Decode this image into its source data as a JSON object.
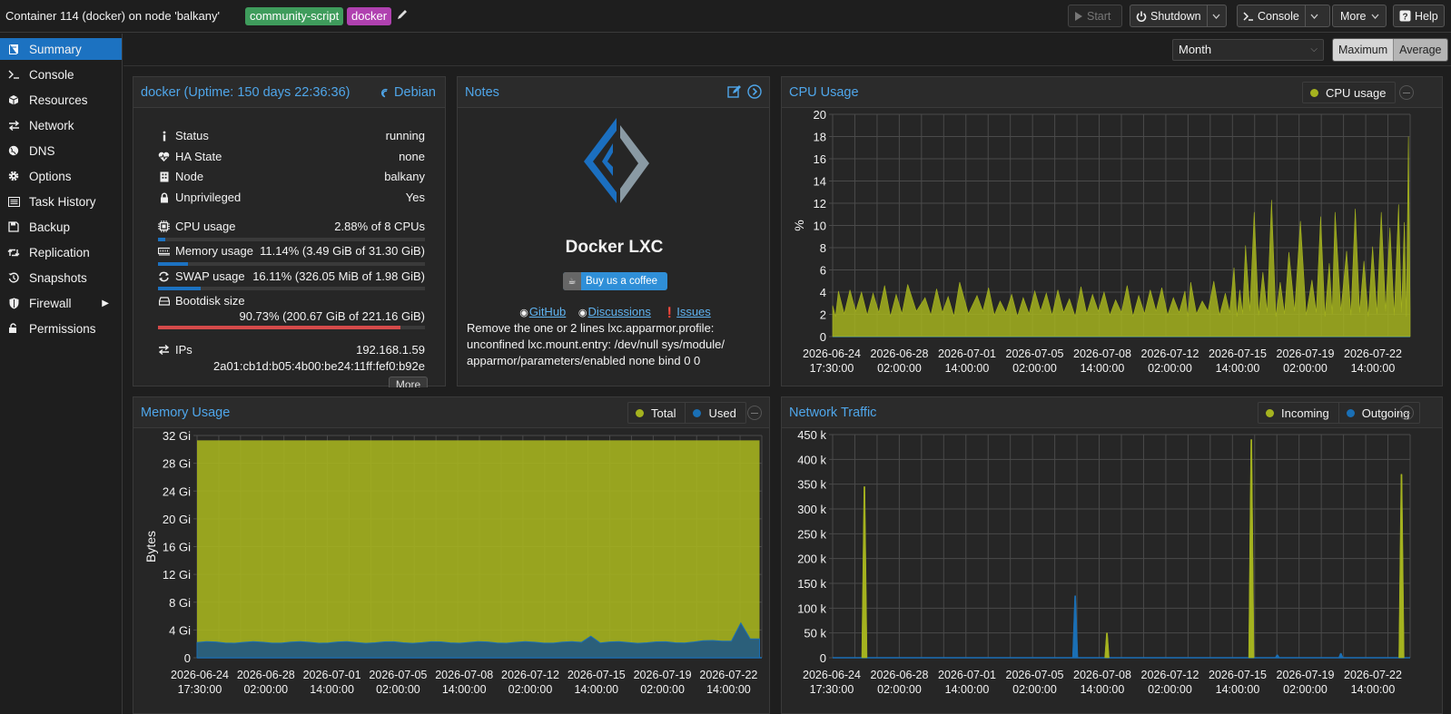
{
  "header": {
    "title": "Container 114 (docker) on node 'balkany'",
    "tags": [
      "community-script",
      "docker"
    ],
    "buttons": {
      "start": "Start",
      "shutdown": "Shutdown",
      "console": "Console",
      "more": "More",
      "help": "Help"
    }
  },
  "sidebar": {
    "items": [
      {
        "label": "Summary",
        "icon": "book-icon"
      },
      {
        "label": "Console",
        "icon": "terminal-icon"
      },
      {
        "label": "Resources",
        "icon": "cube-icon"
      },
      {
        "label": "Network",
        "icon": "exchange-icon"
      },
      {
        "label": "DNS",
        "icon": "globe-icon"
      },
      {
        "label": "Options",
        "icon": "gear-icon"
      },
      {
        "label": "Task History",
        "icon": "list-icon"
      },
      {
        "label": "Backup",
        "icon": "floppy-icon"
      },
      {
        "label": "Replication",
        "icon": "retweet-icon"
      },
      {
        "label": "Snapshots",
        "icon": "history-icon"
      },
      {
        "label": "Firewall",
        "icon": "shield-icon"
      },
      {
        "label": "Permissions",
        "icon": "unlock-icon"
      }
    ]
  },
  "toolbar": {
    "timeframe": "Month",
    "consolidation": [
      "Maximum",
      "Average"
    ]
  },
  "status": {
    "title": "docker (Uptime: 150 days 22:36:36)",
    "os": "Debian",
    "status_label": "Status",
    "status_value": "running",
    "ha_label": "HA State",
    "ha_value": "none",
    "node_label": "Node",
    "node_value": "balkany",
    "unpriv_label": "Unprivileged",
    "unpriv_value": "Yes",
    "cpu_label": "CPU usage",
    "cpu_value": "2.88% of 8 CPUs",
    "cpu_fraction": 0.0288,
    "mem_label": "Memory usage",
    "mem_value": "11.14% (3.49 GiB of 31.30 GiB)",
    "mem_fraction": 0.1114,
    "swap_label": "SWAP usage",
    "swap_value": "16.11% (326.05 MiB of 1.98 GiB)",
    "swap_fraction": 0.1611,
    "disk_label": "Bootdisk size",
    "disk_value": "90.73% (200.67 GiB of 221.16 GiB)",
    "disk_fraction": 0.9073,
    "ips_label": "IPs",
    "ip4": "192.168.1.59",
    "ip6": "2a01:cb1d:b05:4b00:be24:11ff:fef0:b92e",
    "more": "More"
  },
  "notes": {
    "title": "Notes",
    "heading": "Docker LXC",
    "coffee": "Buy us a coffee",
    "links": [
      "GitHub",
      "Discussions",
      "Issues"
    ],
    "body": "Remove the one or 2 lines lxc.apparmor.profile: unconfined lxc.mount.entry: /dev/null sys/module/ apparmor/parameters/enabled none bind 0 0"
  },
  "colors": {
    "accent": "#4fa6ea",
    "olive": "#a5b31f",
    "blue": "#1a6fb5",
    "danger": "#d64a4a"
  },
  "chart_data": [
    {
      "type": "area",
      "title": "CPU Usage",
      "ylabel": "%",
      "ylim": [
        0,
        20
      ],
      "yticks": [
        0,
        2,
        4,
        6,
        8,
        10,
        12,
        14,
        16,
        18,
        20
      ],
      "xticks": [
        [
          "2026-06-24",
          "17:30:00"
        ],
        [
          "2026-06-28",
          "02:00:00"
        ],
        [
          "2026-07-01",
          "14:00:00"
        ],
        [
          "2026-07-05",
          "02:00:00"
        ],
        [
          "2026-07-08",
          "14:00:00"
        ],
        [
          "2026-07-12",
          "02:00:00"
        ],
        [
          "2026-07-15",
          "14:00:00"
        ],
        [
          "2026-07-19",
          "02:00:00"
        ],
        [
          "2026-07-22",
          "14:00:00"
        ]
      ],
      "series": [
        {
          "name": "CPU usage",
          "color": "#a5b31f",
          "peaks": [
            [
              0.01,
              4.1
            ],
            [
              0.03,
              4.2
            ],
            [
              0.05,
              4.0
            ],
            [
              0.07,
              3.9
            ],
            [
              0.09,
              4.6
            ],
            [
              0.11,
              3.8
            ],
            [
              0.13,
              4.7
            ],
            [
              0.16,
              3.5
            ],
            [
              0.18,
              4.3
            ],
            [
              0.2,
              3.6
            ],
            [
              0.22,
              4.9
            ],
            [
              0.25,
              3.7
            ],
            [
              0.27,
              4.4
            ],
            [
              0.29,
              3.2
            ],
            [
              0.31,
              3.8
            ],
            [
              0.33,
              3.5
            ],
            [
              0.35,
              4.1
            ],
            [
              0.37,
              3.9
            ],
            [
              0.39,
              4.2
            ],
            [
              0.41,
              3.4
            ],
            [
              0.43,
              4.5
            ],
            [
              0.45,
              3.8
            ],
            [
              0.47,
              4.0
            ],
            [
              0.49,
              3.3
            ],
            [
              0.51,
              4.6
            ],
            [
              0.53,
              3.7
            ],
            [
              0.55,
              4.2
            ],
            [
              0.57,
              4.4
            ],
            [
              0.59,
              3.5
            ],
            [
              0.61,
              4.1
            ],
            [
              0.62,
              4.9
            ],
            [
              0.64,
              3.2
            ],
            [
              0.66,
              5.0
            ],
            [
              0.68,
              3.9
            ],
            [
              0.695,
              6.2
            ],
            [
              0.705,
              4.2
            ],
            [
              0.715,
              8.2
            ],
            [
              0.73,
              11.2
            ],
            [
              0.745,
              5.8
            ],
            [
              0.76,
              12.3
            ],
            [
              0.775,
              4.9
            ],
            [
              0.79,
              7.6
            ],
            [
              0.81,
              10.4
            ],
            [
              0.83,
              5.1
            ],
            [
              0.845,
              10.8
            ],
            [
              0.86,
              6.6
            ],
            [
              0.87,
              11.2
            ],
            [
              0.89,
              7.7
            ],
            [
              0.905,
              11.5
            ],
            [
              0.92,
              6.8
            ],
            [
              0.935,
              8.1
            ],
            [
              0.95,
              11.2
            ],
            [
              0.965,
              9.8
            ],
            [
              0.98,
              11.9
            ],
            [
              0.99,
              10.3
            ],
            [
              0.997,
              18.0
            ]
          ],
          "baseline": 1.8
        }
      ]
    },
    {
      "type": "area",
      "title": "Memory Usage",
      "ylabel": "Bytes",
      "ylim": [
        0,
        32
      ],
      "ytick_labels": [
        "0",
        "4 Gi",
        "8 Gi",
        "12 Gi",
        "16 Gi",
        "20 Gi",
        "24 Gi",
        "28 Gi",
        "32 Gi"
      ],
      "xticks": [
        [
          "2026-06-24",
          "17:30:00"
        ],
        [
          "2026-06-28",
          "02:00:00"
        ],
        [
          "2026-07-01",
          "14:00:00"
        ],
        [
          "2026-07-05",
          "02:00:00"
        ],
        [
          "2026-07-08",
          "14:00:00"
        ],
        [
          "2026-07-12",
          "02:00:00"
        ],
        [
          "2026-07-15",
          "14:00:00"
        ],
        [
          "2026-07-19",
          "02:00:00"
        ],
        [
          "2026-07-22",
          "14:00:00"
        ]
      ],
      "series": [
        {
          "name": "Total",
          "color": "#a5b31f",
          "value": 31.3
        },
        {
          "name": "Used",
          "color": "#1a6fb5",
          "base": 2.2,
          "end_peak": 5.0
        }
      ]
    },
    {
      "type": "area",
      "title": "Network Traffic",
      "ylim": [
        0,
        450000
      ],
      "ytick_labels": [
        "0",
        "50 k",
        "100 k",
        "150 k",
        "200 k",
        "250 k",
        "300 k",
        "350 k",
        "400 k",
        "450 k"
      ],
      "xticks": [
        [
          "2026-06-24",
          "17:30:00"
        ],
        [
          "2026-06-28",
          "02:00:00"
        ],
        [
          "2026-07-01",
          "14:00:00"
        ],
        [
          "2026-07-05",
          "02:00:00"
        ],
        [
          "2026-07-08",
          "14:00:00"
        ],
        [
          "2026-07-12",
          "02:00:00"
        ],
        [
          "2026-07-15",
          "14:00:00"
        ],
        [
          "2026-07-19",
          "02:00:00"
        ],
        [
          "2026-07-22",
          "14:00:00"
        ]
      ],
      "series": [
        {
          "name": "Incoming",
          "color": "#a5b31f",
          "spikes": [
            [
              0.055,
              345000
            ],
            [
              0.475,
              50000
            ],
            [
              0.725,
              440000
            ],
            [
              0.985,
              370000
            ]
          ]
        },
        {
          "name": "Outgoing",
          "color": "#1a6fb5",
          "spikes": [
            [
              0.42,
              125000
            ],
            [
              0.77,
              6000
            ],
            [
              0.88,
              9000
            ]
          ]
        }
      ]
    }
  ]
}
